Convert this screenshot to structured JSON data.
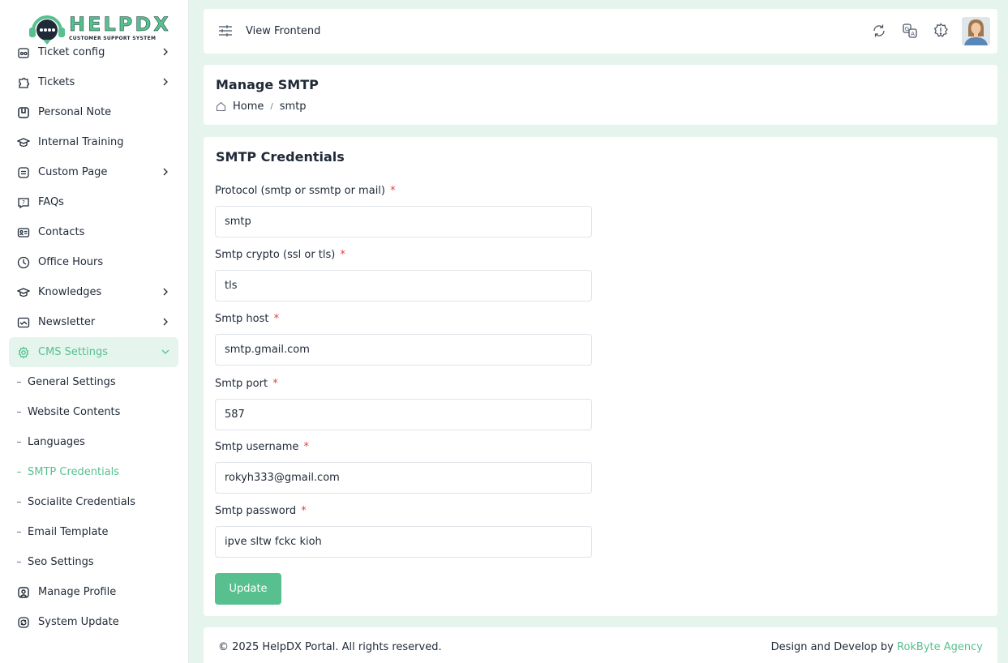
{
  "brand": {
    "name": "HELPDX",
    "tagline": "CUSTOMER SUPPORT SYSTEM",
    "accent": "#57c08e"
  },
  "sidebar": {
    "items": [
      {
        "label": "Ticket config",
        "icon": "ticket-config-icon",
        "has_chevron": true
      },
      {
        "label": "Tickets",
        "icon": "tickets-icon",
        "has_chevron": true
      },
      {
        "label": "Personal Note",
        "icon": "note-icon",
        "has_chevron": false
      },
      {
        "label": "Internal Training",
        "icon": "training-icon",
        "has_chevron": false
      },
      {
        "label": "Custom Page",
        "icon": "page-icon",
        "has_chevron": true
      },
      {
        "label": "FAQs",
        "icon": "faq-icon",
        "has_chevron": false
      },
      {
        "label": "Contacts",
        "icon": "contacts-icon",
        "has_chevron": false
      },
      {
        "label": "Office Hours",
        "icon": "clock-icon",
        "has_chevron": false
      },
      {
        "label": "Knowledges",
        "icon": "knowledge-icon",
        "has_chevron": true
      },
      {
        "label": "Newsletter",
        "icon": "newsletter-icon",
        "has_chevron": true
      },
      {
        "label": "CMS Settings",
        "icon": "gear-icon",
        "has_chevron": true,
        "active": true
      }
    ],
    "sub_items": [
      {
        "label": "General Settings"
      },
      {
        "label": "Website Contents"
      },
      {
        "label": "Languages"
      },
      {
        "label": "SMTP Credentials",
        "active": true
      },
      {
        "label": "Socialite Credentials"
      },
      {
        "label": "Email Template"
      },
      {
        "label": "Seo Settings"
      }
    ],
    "bottom_items": [
      {
        "label": "Manage Profile",
        "icon": "profile-icon"
      },
      {
        "label": "System Update",
        "icon": "update-icon"
      }
    ]
  },
  "header": {
    "view_frontend": "View Frontend",
    "icons": [
      "refresh-icon",
      "translate-icon",
      "alert-icon",
      "avatar"
    ]
  },
  "page": {
    "title": "Manage SMTP",
    "breadcrumb": {
      "home": "Home",
      "separator": "/",
      "current": "smtp"
    }
  },
  "form": {
    "title": "SMTP Credentials",
    "fields": [
      {
        "label": "Protocol (smtp or ssmtp or mail)",
        "required": "*",
        "value": "smtp"
      },
      {
        "label": "Smtp crypto (ssl or tls)",
        "required": "*",
        "value": "tls"
      },
      {
        "label": "Smtp host",
        "required": "*",
        "value": "smtp.gmail.com"
      },
      {
        "label": "Smtp port",
        "required": "*",
        "value": "587"
      },
      {
        "label": "Smtp username",
        "required": "*",
        "value": "rokyh333@gmail.com"
      },
      {
        "label": "Smtp password",
        "required": "*",
        "value": "ipve sltw fckc kioh"
      }
    ],
    "submit_label": "Update"
  },
  "footer": {
    "copyright": "© 2025 HelpDX Portal. All rights reserved.",
    "credit_prefix": "Design and Develop by",
    "credit_agency": "RokByte Agency"
  }
}
